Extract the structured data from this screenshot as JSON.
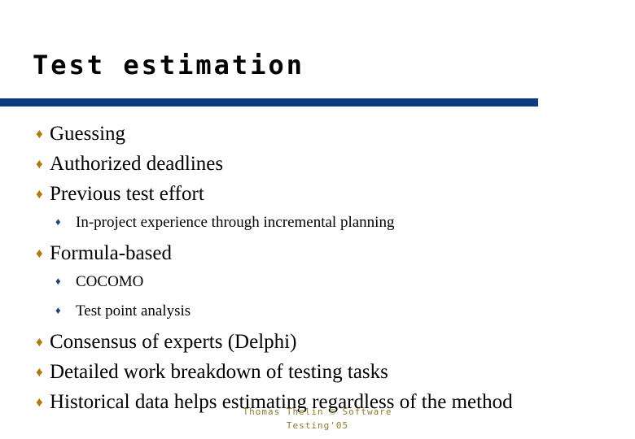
{
  "slide": {
    "title": "Test estimation",
    "accent_color": "#0E3B80",
    "level1_bullet_color": "#B07A10",
    "level2_bullet_color": "#23417F",
    "background_color": "#FFFFFF",
    "bullet_glyph": "♦"
  },
  "content": {
    "items": [
      {
        "level": 1,
        "text": "Guessing"
      },
      {
        "level": 1,
        "text": "Authorized deadlines"
      },
      {
        "level": 1,
        "text": "Previous test effort"
      },
      {
        "level": 2,
        "text": "In-project experience through incremental planning"
      },
      {
        "level": 1,
        "text": "Formula-based"
      },
      {
        "level": 2,
        "text": "COCOMO"
      },
      {
        "level": 2,
        "text": "Test point analysis"
      },
      {
        "level": 1,
        "text": "Consensus of experts (Delphi)"
      },
      {
        "level": 1,
        "text": "Detailed work breakdown of testing tasks"
      },
      {
        "level": 1,
        "text": "Historical data helps estimating regardless of the method"
      }
    ]
  },
  "footer": {
    "line1": "Thomas Thelin © Software",
    "line2": "Testing'05"
  }
}
